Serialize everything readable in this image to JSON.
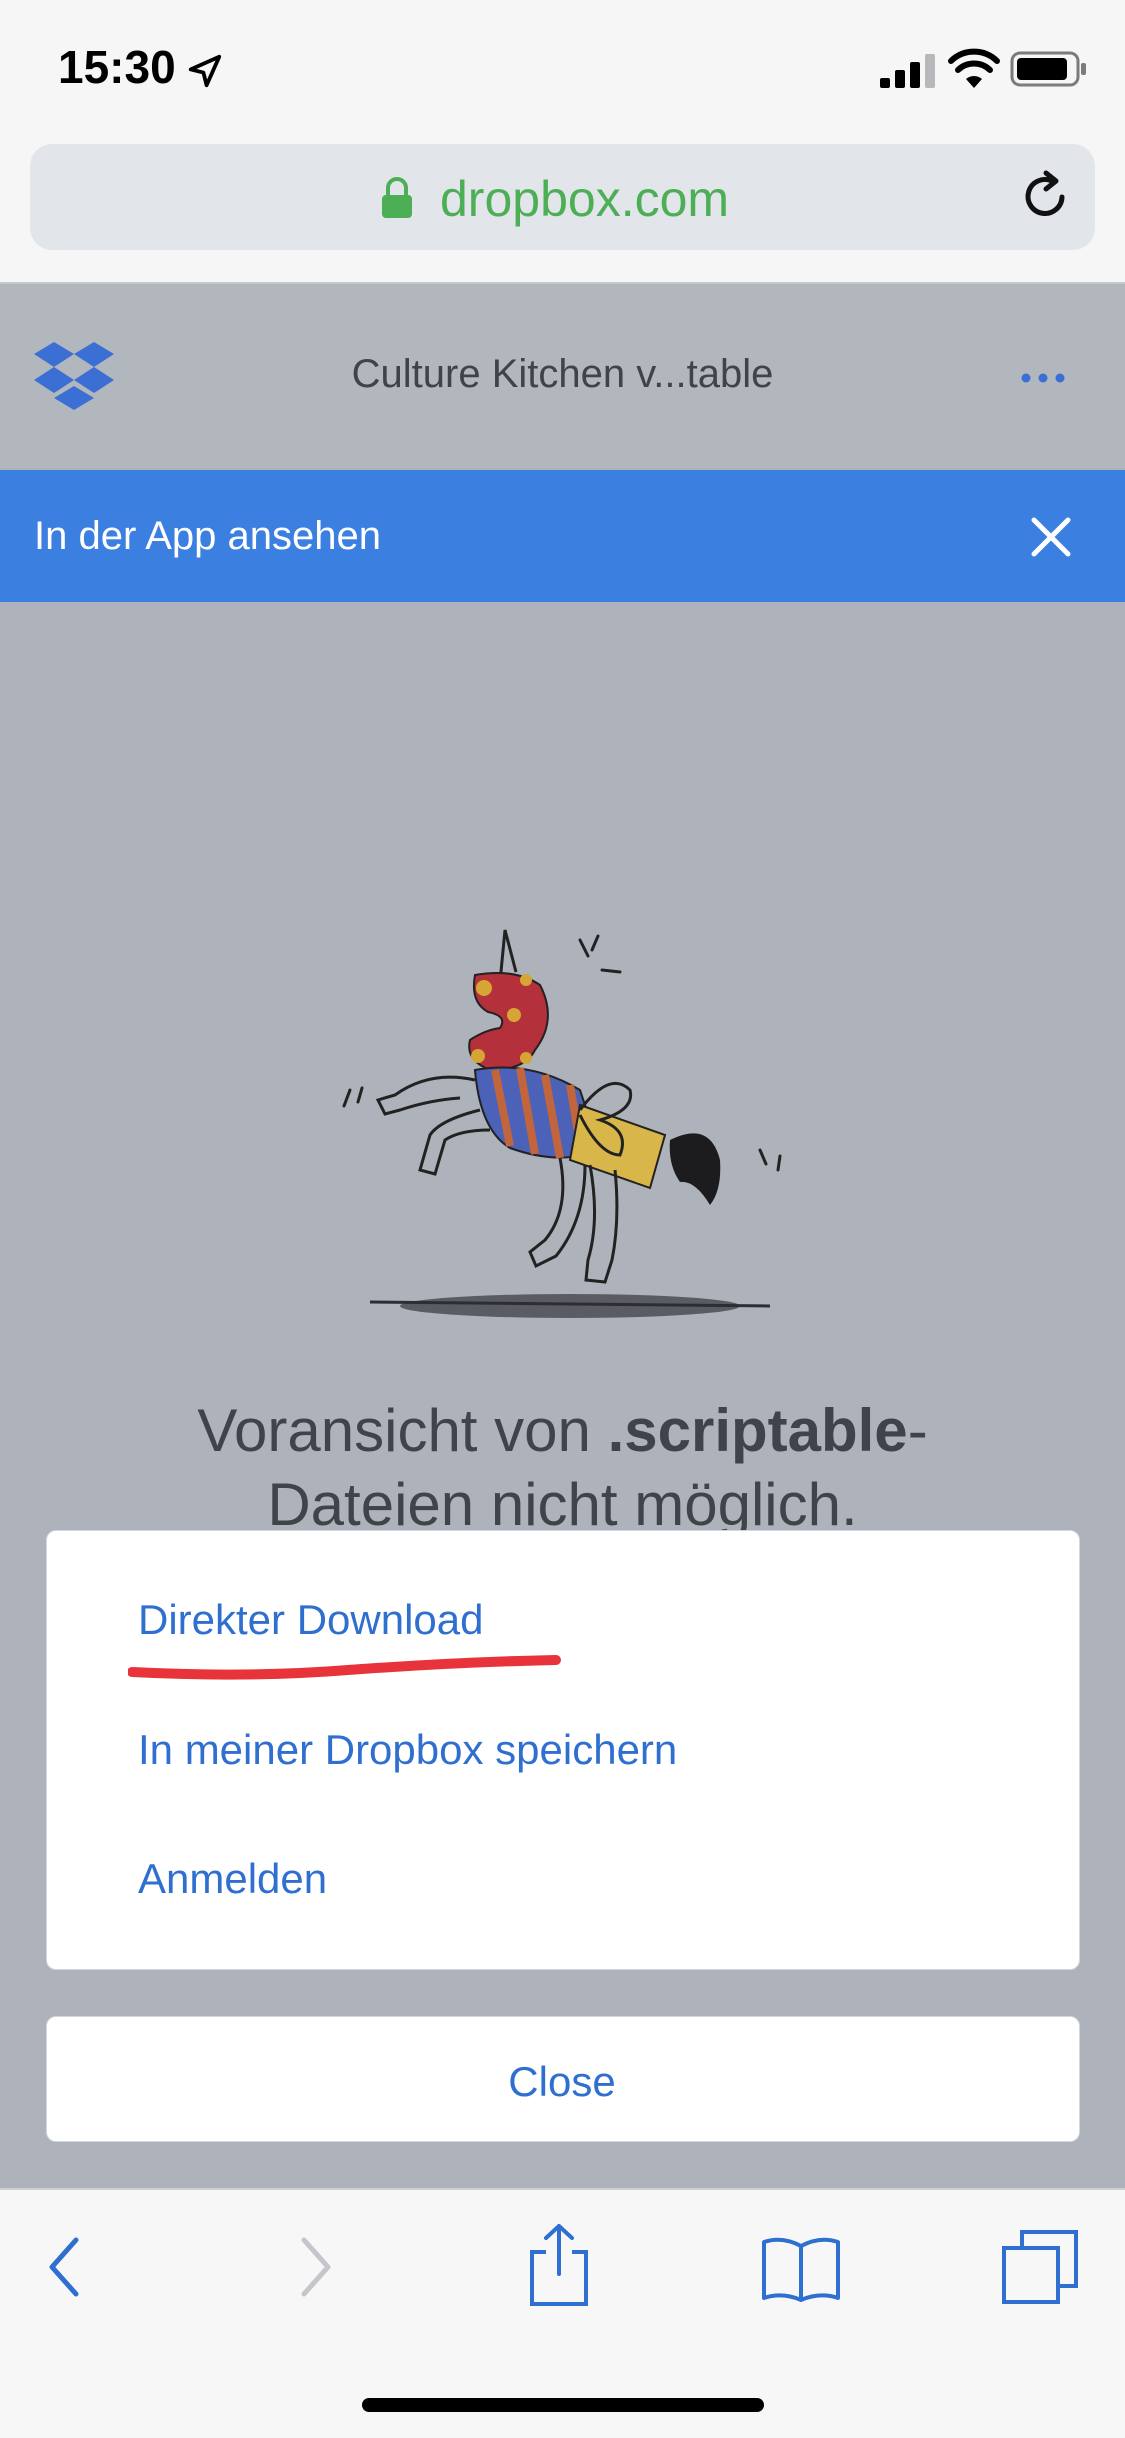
{
  "status_bar": {
    "time": "15:30",
    "icons": [
      "location-arrow-icon",
      "signal-icon",
      "wifi-icon",
      "battery-icon"
    ]
  },
  "browser": {
    "url": "dropbox.com",
    "icons": [
      "lock-icon",
      "reload-icon"
    ]
  },
  "dropbox_header": {
    "file_title": "Culture Kitchen v...table",
    "icons": [
      "dropbox-logo-icon",
      "more-icon"
    ]
  },
  "banner": {
    "label": "In der App ansehen",
    "close_icon": "close-icon"
  },
  "preview": {
    "message_prefix": "Voransicht von ",
    "message_bold": ".scriptable",
    "message_suffix": "-",
    "message_line2": "Dateien nicht möglich."
  },
  "action_sheet": {
    "options": [
      {
        "label": "Direkter Download"
      },
      {
        "label": "In meiner Dropbox speichern"
      },
      {
        "label": "Anmelden"
      }
    ],
    "close_label": "Close"
  },
  "toolbar": {
    "icons": [
      "back-icon",
      "forward-icon",
      "share-icon",
      "bookmarks-icon",
      "tabs-icon"
    ]
  },
  "colors": {
    "accent": "#2f6fd0",
    "banner": "#3b7fe0",
    "url_green": "#4cae55",
    "annotation_red": "#e8333a"
  }
}
